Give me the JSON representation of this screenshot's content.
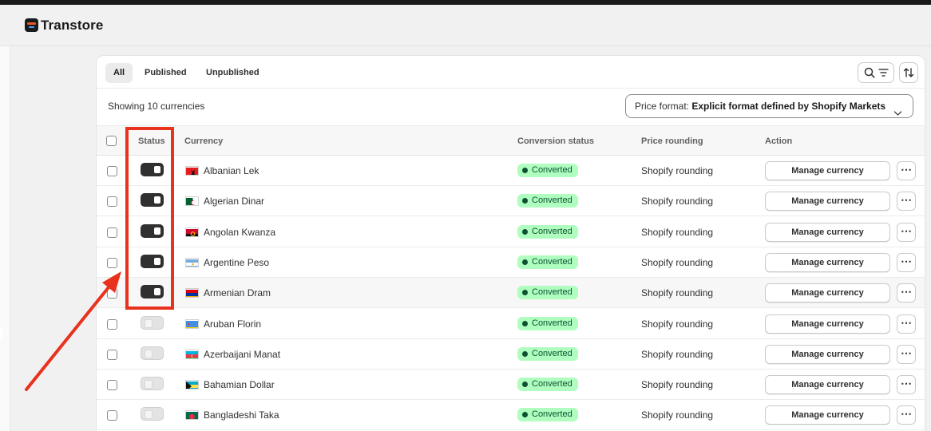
{
  "app": {
    "title": "Transtore"
  },
  "tabs": [
    {
      "label": "All",
      "active": true
    },
    {
      "label": "Published",
      "active": false
    },
    {
      "label": "Unpublished",
      "active": false
    }
  ],
  "toolbar": {
    "search_icon": "search-filter-icon",
    "sort_icon": "sort-icon"
  },
  "summary": {
    "showing": "Showing 10 currencies"
  },
  "price_format": {
    "label": "Price format:",
    "value": "Explicit format defined by Shopify Markets"
  },
  "table": {
    "headers": {
      "status": "Status",
      "currency": "Currency",
      "conversion": "Conversion status",
      "rounding": "Price rounding",
      "action": "Action"
    },
    "rows": [
      {
        "published": true,
        "flag": "albania",
        "currency": "Albanian Lek",
        "conversion": "Converted",
        "rounding": "Shopify rounding",
        "action": "Manage currency"
      },
      {
        "published": true,
        "flag": "algeria",
        "currency": "Algerian Dinar",
        "conversion": "Converted",
        "rounding": "Shopify rounding",
        "action": "Manage currency"
      },
      {
        "published": true,
        "flag": "angola",
        "currency": "Angolan Kwanza",
        "conversion": "Converted",
        "rounding": "Shopify rounding",
        "action": "Manage currency"
      },
      {
        "published": true,
        "flag": "argentina",
        "currency": "Argentine Peso",
        "conversion": "Converted",
        "rounding": "Shopify rounding",
        "action": "Manage currency"
      },
      {
        "published": true,
        "flag": "armenia",
        "currency": "Armenian Dram",
        "conversion": "Converted",
        "rounding": "Shopify rounding",
        "action": "Manage currency"
      },
      {
        "published": false,
        "flag": "aruba",
        "currency": "Aruban Florin",
        "conversion": "Converted",
        "rounding": "Shopify rounding",
        "action": "Manage currency"
      },
      {
        "published": false,
        "flag": "azerbaijan",
        "currency": "Azerbaijani Manat",
        "conversion": "Converted",
        "rounding": "Shopify rounding",
        "action": "Manage currency"
      },
      {
        "published": false,
        "flag": "bahamas",
        "currency": "Bahamian Dollar",
        "conversion": "Converted",
        "rounding": "Shopify rounding",
        "action": "Manage currency"
      },
      {
        "published": false,
        "flag": "bangladesh",
        "currency": "Bangladeshi Taka",
        "conversion": "Converted",
        "rounding": "Shopify rounding",
        "action": "Manage currency"
      }
    ]
  },
  "colors": {
    "annotation": "#e8321e",
    "badge_bg": "#affebf",
    "badge_text": "#0c5132",
    "toggle_on": "#303030"
  }
}
